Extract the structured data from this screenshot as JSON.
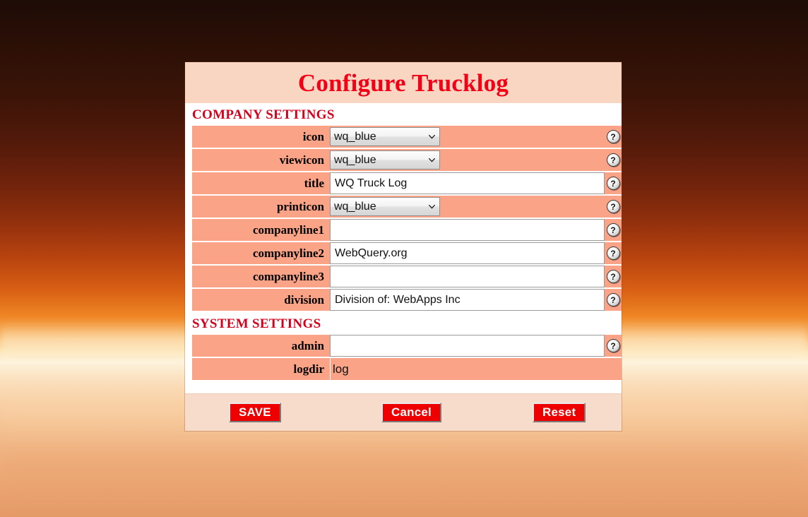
{
  "window": {
    "title": "Configure Trucklog"
  },
  "sections": [
    {
      "heading": "COMPANY SETTINGS",
      "rows": [
        {
          "label": "icon",
          "kind": "select",
          "value": "wq_blue",
          "options": [
            "wq_blue"
          ],
          "help": "?"
        },
        {
          "label": "viewicon",
          "kind": "select",
          "value": "wq_blue",
          "options": [
            "wq_blue"
          ],
          "help": "?"
        },
        {
          "label": "title",
          "kind": "text",
          "value": "WQ Truck Log",
          "placeholder": "",
          "help": "?"
        },
        {
          "label": "printicon",
          "kind": "select",
          "value": "wq_blue",
          "options": [
            "wq_blue"
          ],
          "help": "?"
        },
        {
          "label": "companyline1",
          "kind": "text",
          "value": "",
          "placeholder": "",
          "help": "?"
        },
        {
          "label": "companyline2",
          "kind": "text",
          "value": "WebQuery.org",
          "placeholder": "",
          "help": "?"
        },
        {
          "label": "companyline3",
          "kind": "text",
          "value": "",
          "placeholder": "",
          "help": "?"
        },
        {
          "label": "division",
          "kind": "text",
          "value": "Division of: WebApps Inc",
          "placeholder": "",
          "help": "?"
        }
      ]
    },
    {
      "heading": "SYSTEM SETTINGS",
      "rows": [
        {
          "label": "admin",
          "kind": "text",
          "value": "",
          "placeholder": "",
          "help": "?"
        },
        {
          "label": "logdir",
          "kind": "plain",
          "value": "log",
          "help": ""
        }
      ]
    }
  ],
  "footer": {
    "save_label": "SAVE",
    "cancel_label": "Cancel",
    "reset_label": "Reset"
  },
  "colors": {
    "title_red": "#f30016",
    "section_red": "#d5001c",
    "row_salmon": "#fba387",
    "header_peach": "#f9d6c2",
    "footer_peach": "#f7dccb",
    "button_red": "#ee0000"
  }
}
